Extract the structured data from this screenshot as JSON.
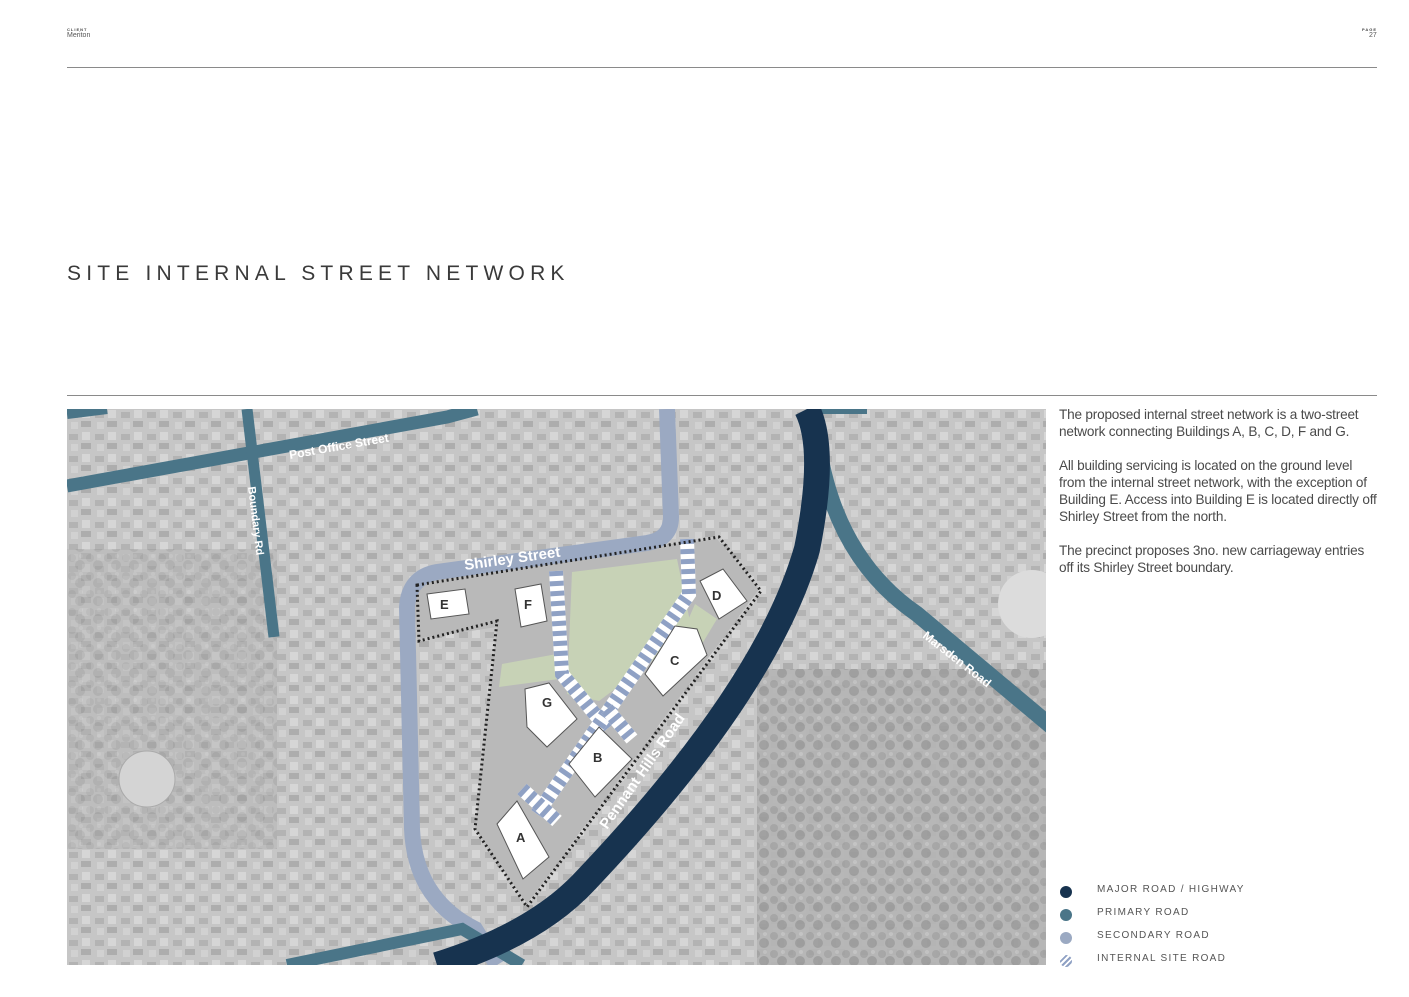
{
  "header": {
    "client_label": "CLIENT",
    "client_value": "Meriton",
    "page_label": "PAGE",
    "page_value": "27"
  },
  "title": "SITE INTERNAL STREET NETWORK",
  "description": [
    "The proposed internal street network is a two-street network connecting Buildings A, B, C, D, F and G.",
    "All building servicing is located on the ground level from the internal street network, with the exception of Building E. Access into Building E is located directly off Shirley Street from the north.",
    "The precinct proposes 3no. new carriageway entries off its Shirley Street boundary."
  ],
  "map": {
    "streets": {
      "post_office": "Post Office Street",
      "boundary": "Boundary Rd",
      "shirley": "Shirley Street",
      "marsden": "Marsden Road",
      "pennant": "Pennant Hills Road"
    },
    "buildings": [
      "A",
      "B",
      "C",
      "D",
      "E",
      "F",
      "G"
    ]
  },
  "legend": [
    {
      "label": "MAJOR ROAD / HIGHWAY",
      "color": "#17334f",
      "icon": "solid-dot"
    },
    {
      "label": "PRIMARY ROAD",
      "color": "#4a7588",
      "icon": "solid-dot"
    },
    {
      "label": "SECONDARY ROAD",
      "color": "#9ba9c2",
      "icon": "solid-dot"
    },
    {
      "label": "INTERNAL SITE ROAD",
      "color": "#8fa1c4",
      "icon": "hatched-dot"
    }
  ]
}
